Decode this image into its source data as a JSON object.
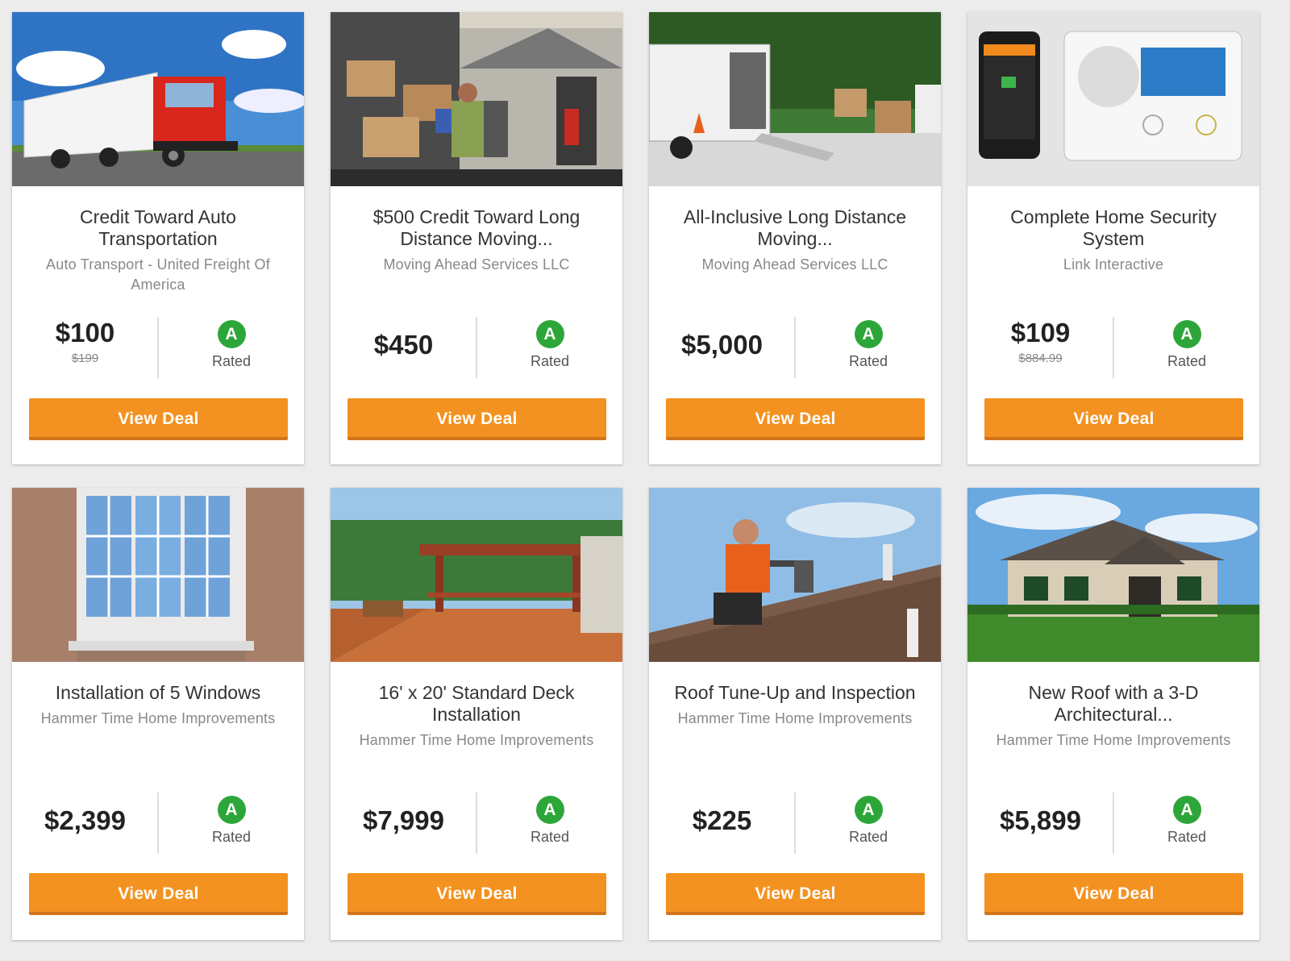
{
  "cards": [
    {
      "title": "Credit Toward Auto Transportation",
      "vendor": "Auto Transport - United Freight Of America",
      "price": "$100",
      "old_price": "$199",
      "grade": "A",
      "rated": "Rated",
      "button": "View Deal"
    },
    {
      "title": "$500 Credit Toward Long Distance Moving...",
      "vendor": "Moving Ahead Services LLC",
      "price": "$450",
      "old_price": "",
      "grade": "A",
      "rated": "Rated",
      "button": "View Deal"
    },
    {
      "title": "All-Inclusive Long Distance Moving...",
      "vendor": "Moving Ahead Services LLC",
      "price": "$5,000",
      "old_price": "",
      "grade": "A",
      "rated": "Rated",
      "button": "View Deal"
    },
    {
      "title": "Complete Home Security System",
      "vendor": "Link Interactive",
      "price": "$109",
      "old_price": "$884.99",
      "grade": "A",
      "rated": "Rated",
      "button": "View Deal"
    },
    {
      "title": "Installation of 5 Windows",
      "vendor": "Hammer Time Home Improvements",
      "price": "$2,399",
      "old_price": "",
      "grade": "A",
      "rated": "Rated",
      "button": "View Deal"
    },
    {
      "title": "16' x 20' Standard Deck Installation",
      "vendor": "Hammer Time Home Improvements",
      "price": "$7,999",
      "old_price": "",
      "grade": "A",
      "rated": "Rated",
      "button": "View Deal"
    },
    {
      "title": "Roof Tune-Up and Inspection",
      "vendor": "Hammer Time Home Improvements",
      "price": "$225",
      "old_price": "",
      "grade": "A",
      "rated": "Rated",
      "button": "View Deal"
    },
    {
      "title": "New Roof with a 3-D Architectural...",
      "vendor": "Hammer Time Home Improvements",
      "price": "$5,899",
      "old_price": "",
      "grade": "A",
      "rated": "Rated",
      "button": "View Deal"
    }
  ],
  "colors": {
    "button": "#f39220",
    "button_shadow": "#d2751a",
    "grade_badge": "#2da639",
    "page_bg": "#ececec"
  }
}
